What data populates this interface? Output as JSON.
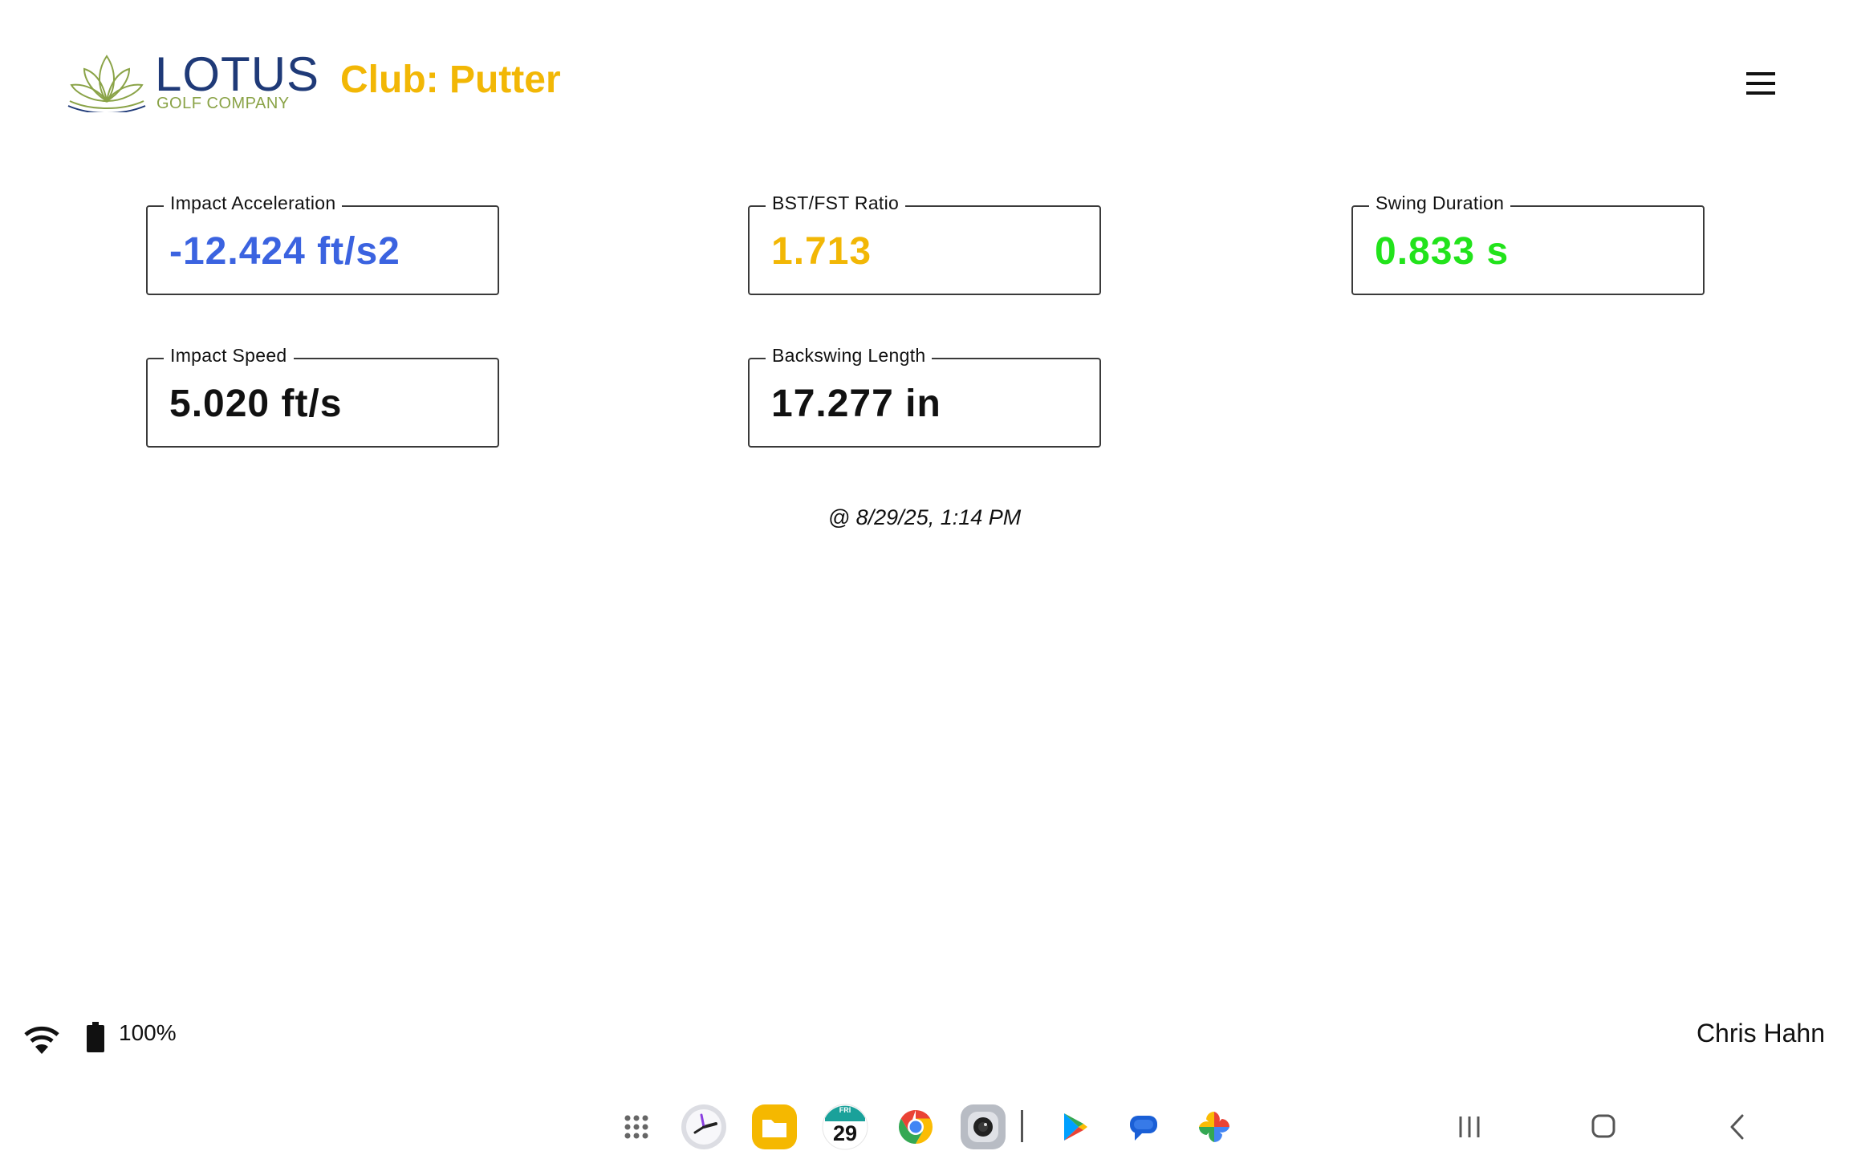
{
  "header": {
    "logo_word": "LOTUS",
    "logo_sub": "GOLF COMPANY",
    "club_title": "Club: Putter"
  },
  "metrics": [
    {
      "label": "Impact Acceleration",
      "value": "-12.424 ft/s2",
      "color": "#3b63e0"
    },
    {
      "label": "BST/FST Ratio",
      "value": "1.713",
      "color": "#f2b705"
    },
    {
      "label": "Swing Duration",
      "value": "0.833 s",
      "color": "#22e31b"
    },
    {
      "label": "Impact Speed",
      "value": "5.020 ft/s",
      "color": "#111111"
    },
    {
      "label": "Backswing Length",
      "value": "17.277 in",
      "color": "#111111"
    }
  ],
  "timestamp": "@ 8/29/25, 1:14 PM",
  "status": {
    "battery": "100%",
    "user": "Chris Hahn"
  },
  "dock": {
    "calendar_day": "FRI",
    "calendar_date": "29",
    "icons": [
      "apps-grid-icon",
      "clock-icon",
      "files-icon",
      "calendar-icon",
      "chrome-icon",
      "camera-icon",
      "play-store-icon",
      "messages-icon",
      "photos-icon"
    ]
  },
  "nav": [
    "recents-icon",
    "home-icon",
    "back-icon"
  ]
}
